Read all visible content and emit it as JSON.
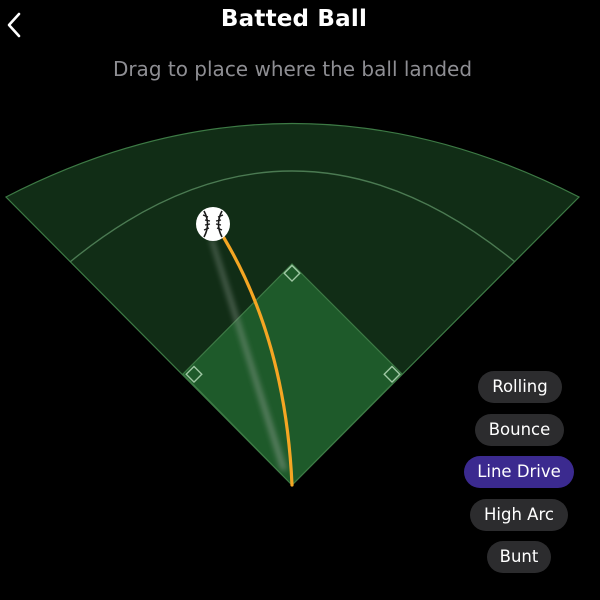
{
  "header": {
    "title": "Batted Ball",
    "back_icon": "chevron-left-icon"
  },
  "instruction": "Drag to place where the ball landed",
  "field": {
    "ball_icon": "baseball-icon",
    "trajectory_color": "#f5a623",
    "field_color": "#1e5a28",
    "outfield_color": "#123118"
  },
  "ball_types": {
    "options": [
      {
        "label": "Rolling",
        "selected": false
      },
      {
        "label": "Bounce",
        "selected": false
      },
      {
        "label": "Line Drive",
        "selected": true
      },
      {
        "label": "High Arc",
        "selected": false
      },
      {
        "label": "Bunt",
        "selected": false
      }
    ],
    "selected_color": "#3b2a8f",
    "default_color": "#2c2c2e"
  }
}
